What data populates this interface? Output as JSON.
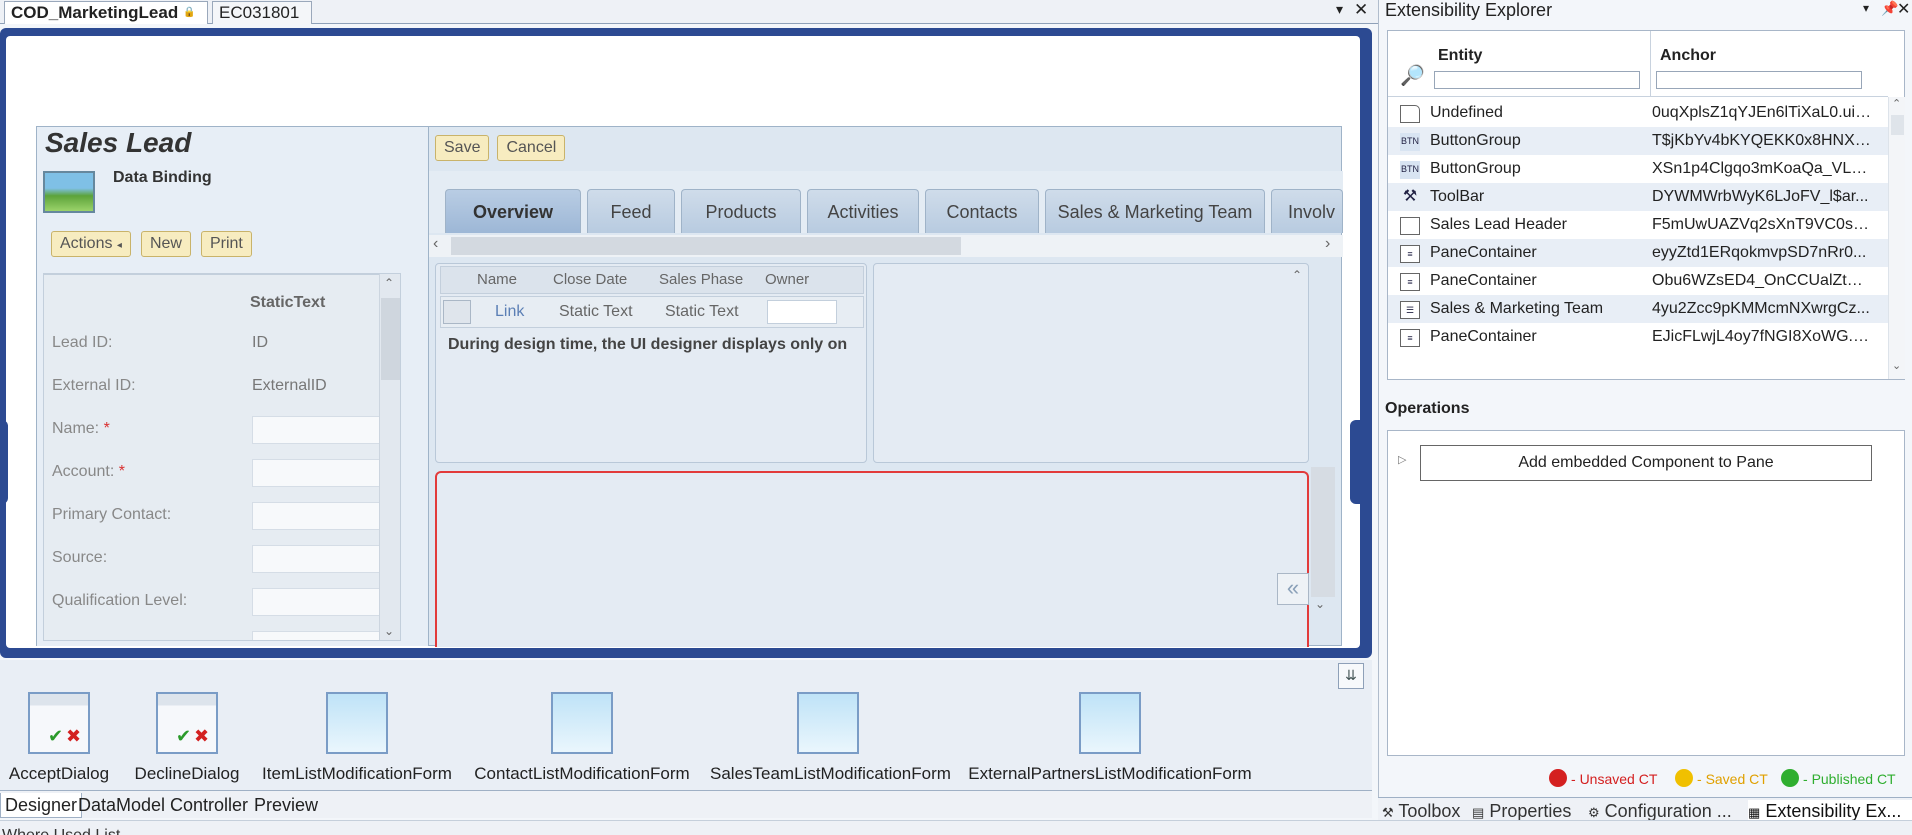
{
  "doc_tabs": {
    "active": "COD_MarketingLead",
    "other": "EC031801"
  },
  "form": {
    "title": "Sales Lead",
    "data_binding": "Data Binding",
    "actions": {
      "actions_label": "Actions",
      "new_label": "New",
      "print_label": "Print"
    },
    "toolbar": {
      "save_label": "Save",
      "cancel_label": "Cancel"
    },
    "fields_header": "StaticText",
    "fields": [
      {
        "label": "Lead ID:",
        "value": "ID"
      },
      {
        "label": "External ID:",
        "value": "ExternalID"
      },
      {
        "label": "Name:",
        "required": "*"
      },
      {
        "label": "Account:",
        "required": "*"
      },
      {
        "label": "Primary Contact:"
      },
      {
        "label": "Source:"
      },
      {
        "label": "Qualification Level:"
      }
    ],
    "tabs": [
      "Overview",
      "Feed",
      "Products",
      "Activities",
      "Contacts",
      "Sales & Marketing Team",
      "Involv"
    ],
    "opp_table": {
      "columns": [
        "Name",
        "Close Date",
        "Sales Phase",
        "Owner"
      ],
      "row": {
        "link": "Link",
        "close": "Static Text",
        "phase": "Static Text"
      },
      "note": "During design time, the UI designer displays only on"
    }
  },
  "components": [
    "AcceptDialog",
    "DeclineDialog",
    "ItemListModificationForm",
    "ContactListModificationForm",
    "SalesTeamListModificationForm",
    "ExternalPartnersListModificationForm"
  ],
  "view_tabs": [
    "Designer",
    "DataModel",
    "Controller",
    "Preview"
  ],
  "explorer": {
    "title": "Extensibility Explorer",
    "col_entity": "Entity",
    "col_anchor": "Anchor",
    "rows": [
      {
        "entity": "Undefined",
        "anchor": "0uqXplsZ1qYJEn6lTiXaL0.uia...",
        "icon": "doc-icon"
      },
      {
        "entity": "ButtonGroup",
        "anchor": "T$jKbYv4bKYQEKK0x8HNXW...",
        "icon": "buttongroup-icon"
      },
      {
        "entity": "ButtonGroup",
        "anchor": "XSn1p4Clgqo3mKoaQa_VLn...",
        "icon": "buttongroup-icon"
      },
      {
        "entity": "ToolBar",
        "anchor": "DYWMWrbWyK6LJoFV_l$ar...",
        "icon": "tools-icon"
      },
      {
        "entity": "Sales Lead Header",
        "anchor": "F5mUwUAZVq2sXnT9VC0sC...",
        "icon": "header-icon"
      },
      {
        "entity": "PaneContainer",
        "anchor": "eyyZtd1ERqokmvpSD7nRr0...",
        "icon": "pane-icon"
      },
      {
        "entity": "PaneContainer",
        "anchor": "Obu6WZsED4_OnCCUalZtR(...",
        "icon": "pane-icon"
      },
      {
        "entity": "Sales & Marketing Team",
        "anchor": "4yu2Zcc9pKMMcmNXwrgCz...",
        "icon": "list-icon"
      },
      {
        "entity": "PaneContainer",
        "anchor": "EJicFLwjL4oy7fNGI8XoWG.u...",
        "icon": "pane-icon"
      }
    ],
    "operations_title": "Operations",
    "operation": "Add embedded Component to Pane",
    "legend": {
      "unsaved": "Unsaved CT",
      "saved": "Saved CT",
      "published": "Published CT"
    },
    "legend_colors": {
      "unsaved": "#d42020",
      "saved": "#f0c000",
      "published": "#2fae2f"
    }
  },
  "tool_tabs": [
    "Toolbox",
    "Properties",
    "Configuration ...",
    "Extensibility Ex..."
  ],
  "status_text": "Where Used List"
}
